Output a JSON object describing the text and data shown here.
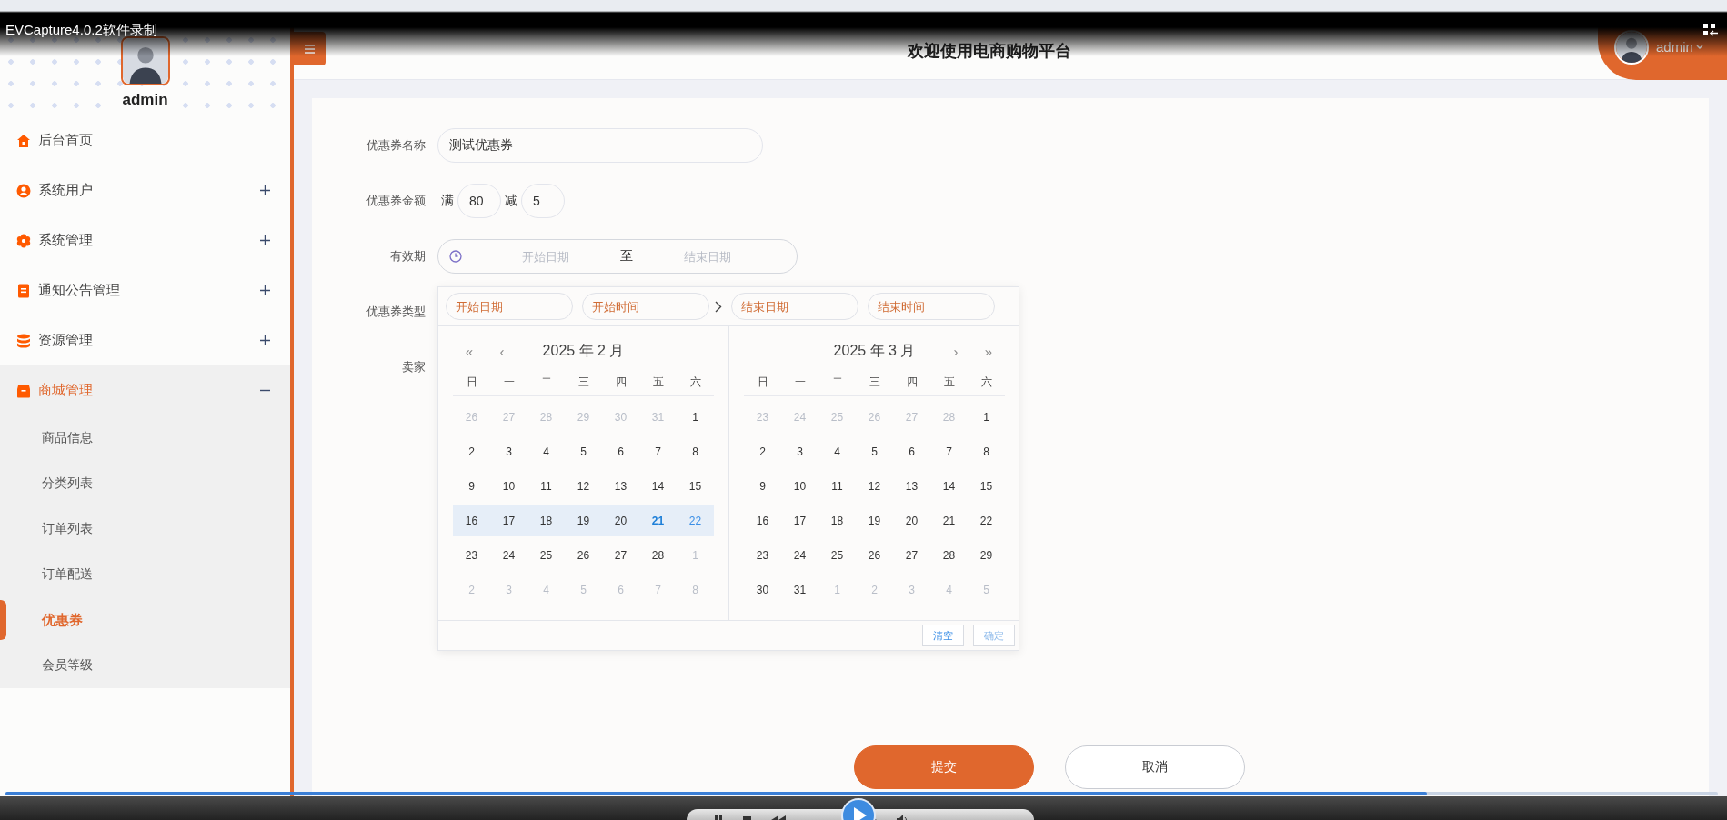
{
  "recorder": {
    "title": "EVCapture4.0.2软件录制",
    "progress": {
      "level": 0.83
    }
  },
  "header": {
    "title": "欢迎使用电商购物平台",
    "user": "admin"
  },
  "sidebar": {
    "user": "admin",
    "items": [
      {
        "label": "后台首页",
        "kind": "link"
      },
      {
        "label": "系统用户",
        "kind": "group",
        "expanded": false
      },
      {
        "label": "系统管理",
        "kind": "group",
        "expanded": false
      },
      {
        "label": "通知公告管理",
        "kind": "group",
        "expanded": false
      },
      {
        "label": "资源管理",
        "kind": "group",
        "expanded": false
      },
      {
        "label": "商城管理",
        "kind": "group",
        "expanded": true,
        "children": [
          {
            "label": "商品信息",
            "selected": false
          },
          {
            "label": "分类列表",
            "selected": false
          },
          {
            "label": "订单列表",
            "selected": false
          },
          {
            "label": "订单配送",
            "selected": false
          },
          {
            "label": "优惠券",
            "selected": true
          },
          {
            "label": "会员等级",
            "selected": false
          }
        ]
      }
    ]
  },
  "form": {
    "rows": [
      {
        "kind": "text",
        "label": "优惠券名称",
        "value": "测试优惠券"
      },
      {
        "kind": "amount",
        "label": "优惠券金额",
        "min_prefix": "满",
        "min_value": "80",
        "off_prefix": "减",
        "off_value": "5"
      },
      {
        "kind": "range",
        "label": "有效期",
        "start_placeholder": "开始日期",
        "separator": "至",
        "end_placeholder": "结束日期"
      },
      {
        "kind": "blank",
        "label": "优惠券类型"
      },
      {
        "kind": "blank",
        "label": "卖家"
      }
    ],
    "buttons": [
      {
        "label": "提交",
        "kind": "primary"
      },
      {
        "label": "取消",
        "kind": "default"
      }
    ]
  },
  "date_picker": {
    "inputs": [
      {
        "placeholder": "开始日期"
      },
      {
        "placeholder": "开始时间"
      },
      {
        "placeholder": "结束日期"
      },
      {
        "placeholder": "结束时间"
      }
    ],
    "months": [
      {
        "title": "2025 年 2 月",
        "nav_left": [
          "«",
          "‹"
        ],
        "weekdays": [
          "日",
          "一",
          "二",
          "三",
          "四",
          "五",
          "六"
        ],
        "days": [
          {
            "text": "26",
            "outside": true,
            "in_range": false,
            "today": false,
            "selected": false
          },
          {
            "text": "27",
            "outside": true,
            "in_range": false,
            "today": false,
            "selected": false
          },
          {
            "text": "28",
            "outside": true,
            "in_range": false,
            "today": false,
            "selected": false
          },
          {
            "text": "29",
            "outside": true,
            "in_range": false,
            "today": false,
            "selected": false
          },
          {
            "text": "30",
            "outside": true,
            "in_range": false,
            "today": false,
            "selected": false
          },
          {
            "text": "31",
            "outside": true,
            "in_range": false,
            "today": false,
            "selected": false
          },
          {
            "text": "1",
            "outside": false,
            "in_range": false,
            "today": false,
            "selected": false
          },
          {
            "text": "2",
            "outside": false,
            "in_range": false,
            "today": false,
            "selected": false
          },
          {
            "text": "3",
            "outside": false,
            "in_range": false,
            "today": false,
            "selected": false
          },
          {
            "text": "4",
            "outside": false,
            "in_range": false,
            "today": false,
            "selected": false
          },
          {
            "text": "5",
            "outside": false,
            "in_range": false,
            "today": false,
            "selected": false
          },
          {
            "text": "6",
            "outside": false,
            "in_range": false,
            "today": false,
            "selected": false
          },
          {
            "text": "7",
            "outside": false,
            "in_range": false,
            "today": false,
            "selected": false
          },
          {
            "text": "8",
            "outside": false,
            "in_range": false,
            "today": false,
            "selected": false
          },
          {
            "text": "9",
            "outside": false,
            "in_range": false,
            "today": false,
            "selected": false
          },
          {
            "text": "10",
            "outside": false,
            "in_range": false,
            "today": false,
            "selected": false
          },
          {
            "text": "11",
            "outside": false,
            "in_range": false,
            "today": false,
            "selected": false
          },
          {
            "text": "12",
            "outside": false,
            "in_range": false,
            "today": false,
            "selected": false
          },
          {
            "text": "13",
            "outside": false,
            "in_range": false,
            "today": false,
            "selected": false
          },
          {
            "text": "14",
            "outside": false,
            "in_range": false,
            "today": false,
            "selected": false
          },
          {
            "text": "15",
            "outside": false,
            "in_range": false,
            "today": false,
            "selected": false
          },
          {
            "text": "16",
            "outside": false,
            "in_range": true,
            "today": false,
            "selected": false
          },
          {
            "text": "17",
            "outside": false,
            "in_range": true,
            "today": false,
            "selected": false
          },
          {
            "text": "18",
            "outside": false,
            "in_range": true,
            "today": false,
            "selected": false
          },
          {
            "text": "19",
            "outside": false,
            "in_range": true,
            "today": false,
            "selected": false
          },
          {
            "text": "20",
            "outside": false,
            "in_range": true,
            "today": false,
            "selected": false
          },
          {
            "text": "21",
            "outside": false,
            "in_range": true,
            "today": true,
            "selected": false
          },
          {
            "text": "22",
            "outside": false,
            "in_range": true,
            "today": false,
            "selected": true
          },
          {
            "text": "23",
            "outside": false,
            "in_range": false,
            "today": false,
            "selected": false
          },
          {
            "text": "24",
            "outside": false,
            "in_range": false,
            "today": false,
            "selected": false
          },
          {
            "text": "25",
            "outside": false,
            "in_range": false,
            "today": false,
            "selected": false
          },
          {
            "text": "26",
            "outside": false,
            "in_range": false,
            "today": false,
            "selected": false
          },
          {
            "text": "27",
            "outside": false,
            "in_range": false,
            "today": false,
            "selected": false
          },
          {
            "text": "28",
            "outside": false,
            "in_range": false,
            "today": false,
            "selected": false
          },
          {
            "text": "1",
            "outside": true,
            "in_range": false,
            "today": false,
            "selected": false
          },
          {
            "text": "2",
            "outside": true,
            "in_range": false,
            "today": false,
            "selected": false
          },
          {
            "text": "3",
            "outside": true,
            "in_range": false,
            "today": false,
            "selected": false
          },
          {
            "text": "4",
            "outside": true,
            "in_range": false,
            "today": false,
            "selected": false
          },
          {
            "text": "5",
            "outside": true,
            "in_range": false,
            "today": false,
            "selected": false
          },
          {
            "text": "6",
            "outside": true,
            "in_range": false,
            "today": false,
            "selected": false
          },
          {
            "text": "7",
            "outside": true,
            "in_range": false,
            "today": false,
            "selected": false
          },
          {
            "text": "8",
            "outside": true,
            "in_range": false,
            "today": false,
            "selected": false
          }
        ]
      },
      {
        "title": "2025 年 3 月",
        "nav_right": [
          "›",
          "»"
        ],
        "weekdays": [
          "日",
          "一",
          "二",
          "三",
          "四",
          "五",
          "六"
        ],
        "days": [
          {
            "text": "23",
            "outside": true,
            "in_range": false,
            "today": false,
            "selected": false
          },
          {
            "text": "24",
            "outside": true,
            "in_range": false,
            "today": false,
            "selected": false
          },
          {
            "text": "25",
            "outside": true,
            "in_range": false,
            "today": false,
            "selected": false
          },
          {
            "text": "26",
            "outside": true,
            "in_range": false,
            "today": false,
            "selected": false
          },
          {
            "text": "27",
            "outside": true,
            "in_range": false,
            "today": false,
            "selected": false
          },
          {
            "text": "28",
            "outside": true,
            "in_range": false,
            "today": false,
            "selected": false
          },
          {
            "text": "1",
            "outside": false,
            "in_range": false,
            "today": false,
            "selected": false
          },
          {
            "text": "2",
            "outside": false,
            "in_range": false,
            "today": false,
            "selected": false
          },
          {
            "text": "3",
            "outside": false,
            "in_range": false,
            "today": false,
            "selected": false
          },
          {
            "text": "4",
            "outside": false,
            "in_range": false,
            "today": false,
            "selected": false
          },
          {
            "text": "5",
            "outside": false,
            "in_range": false,
            "today": false,
            "selected": false
          },
          {
            "text": "6",
            "outside": false,
            "in_range": false,
            "today": false,
            "selected": false
          },
          {
            "text": "7",
            "outside": false,
            "in_range": false,
            "today": false,
            "selected": false
          },
          {
            "text": "8",
            "outside": false,
            "in_range": false,
            "today": false,
            "selected": false
          },
          {
            "text": "9",
            "outside": false,
            "in_range": false,
            "today": false,
            "selected": false
          },
          {
            "text": "10",
            "outside": false,
            "in_range": false,
            "today": false,
            "selected": false
          },
          {
            "text": "11",
            "outside": false,
            "in_range": false,
            "today": false,
            "selected": false
          },
          {
            "text": "12",
            "outside": false,
            "in_range": false,
            "today": false,
            "selected": false
          },
          {
            "text": "13",
            "outside": false,
            "in_range": false,
            "today": false,
            "selected": false
          },
          {
            "text": "14",
            "outside": false,
            "in_range": false,
            "today": false,
            "selected": false
          },
          {
            "text": "15",
            "outside": false,
            "in_range": false,
            "today": false,
            "selected": false
          },
          {
            "text": "16",
            "outside": false,
            "in_range": false,
            "today": false,
            "selected": false
          },
          {
            "text": "17",
            "outside": false,
            "in_range": false,
            "today": false,
            "selected": false
          },
          {
            "text": "18",
            "outside": false,
            "in_range": false,
            "today": false,
            "selected": false
          },
          {
            "text": "19",
            "outside": false,
            "in_range": false,
            "today": false,
            "selected": false
          },
          {
            "text": "20",
            "outside": false,
            "in_range": false,
            "today": false,
            "selected": false
          },
          {
            "text": "21",
            "outside": false,
            "in_range": false,
            "today": false,
            "selected": false
          },
          {
            "text": "22",
            "outside": false,
            "in_range": false,
            "today": false,
            "selected": false
          },
          {
            "text": "23",
            "outside": false,
            "in_range": false,
            "today": false,
            "selected": false
          },
          {
            "text": "24",
            "outside": false,
            "in_range": false,
            "today": false,
            "selected": false
          },
          {
            "text": "25",
            "outside": false,
            "in_range": false,
            "today": false,
            "selected": false
          },
          {
            "text": "26",
            "outside": false,
            "in_range": false,
            "today": false,
            "selected": false
          },
          {
            "text": "27",
            "outside": false,
            "in_range": false,
            "today": false,
            "selected": false
          },
          {
            "text": "28",
            "outside": false,
            "in_range": false,
            "today": false,
            "selected": false
          },
          {
            "text": "29",
            "outside": false,
            "in_range": false,
            "today": false,
            "selected": false
          },
          {
            "text": "30",
            "outside": false,
            "in_range": false,
            "today": false,
            "selected": false
          },
          {
            "text": "31",
            "outside": false,
            "in_range": false,
            "today": false,
            "selected": false
          },
          {
            "text": "1",
            "outside": true,
            "in_range": false,
            "today": false,
            "selected": false
          },
          {
            "text": "2",
            "outside": true,
            "in_range": false,
            "today": false,
            "selected": false
          },
          {
            "text": "3",
            "outside": true,
            "in_range": false,
            "today": false,
            "selected": false
          },
          {
            "text": "4",
            "outside": true,
            "in_range": false,
            "today": false,
            "selected": false
          },
          {
            "text": "5",
            "outside": true,
            "in_range": false,
            "today": false,
            "selected": false
          }
        ]
      }
    ],
    "buttons": [
      {
        "label": "清空",
        "kind": "clear"
      },
      {
        "label": "确定",
        "kind": "confirm"
      }
    ]
  }
}
